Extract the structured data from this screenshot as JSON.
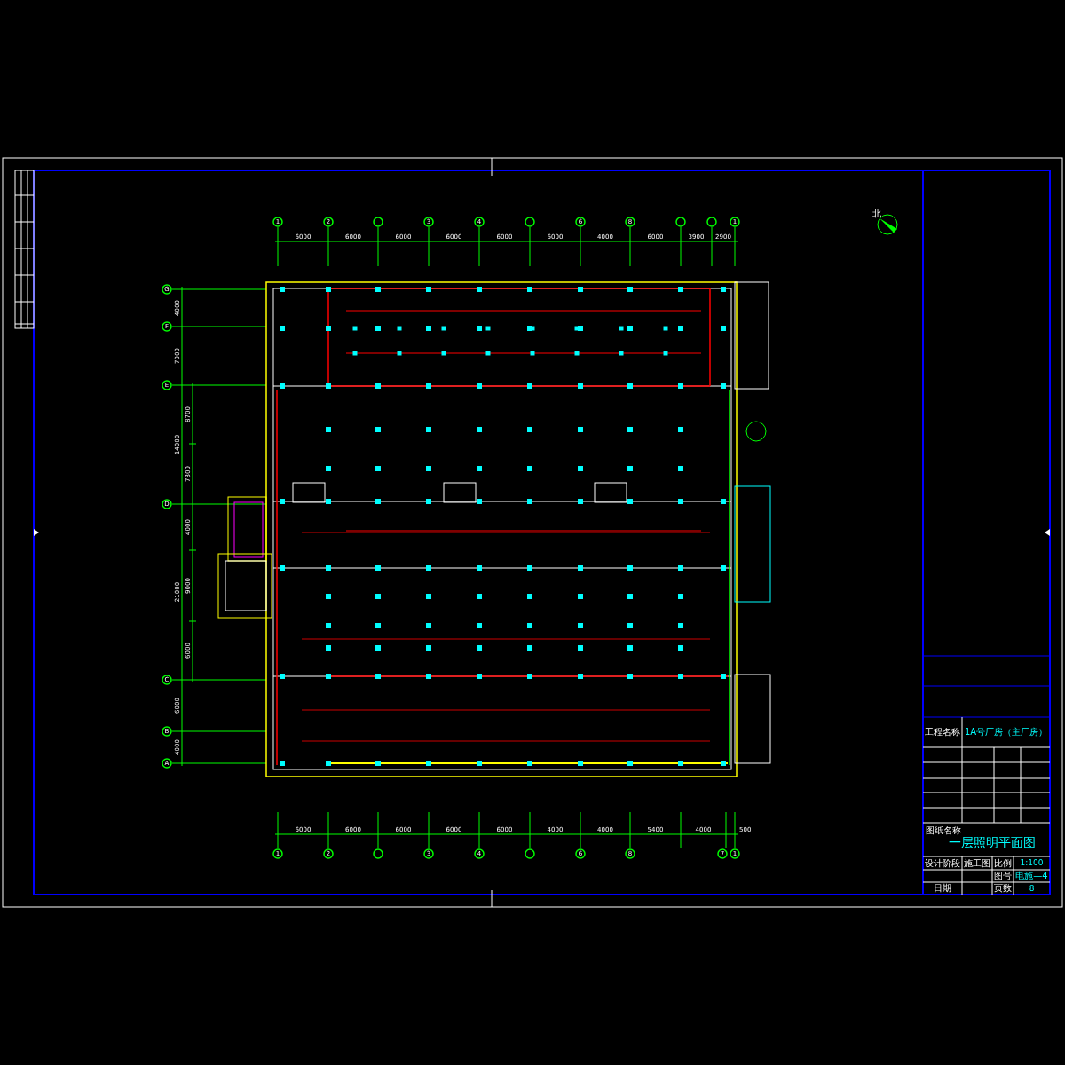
{
  "plan": {
    "north_label": "北",
    "top_axis": [
      {
        "kind": "labeled",
        "label": "1"
      },
      {
        "kind": "labeled",
        "label": "2"
      },
      {
        "kind": "unlabeled"
      },
      {
        "kind": "labeled",
        "label": "3"
      },
      {
        "kind": "labeled",
        "label": "4"
      },
      {
        "kind": "unlabeled"
      },
      {
        "kind": "labeled",
        "label": "6"
      },
      {
        "kind": "labeled",
        "label": "8"
      },
      {
        "kind": "unlabeled"
      },
      {
        "kind": "unlabeled"
      },
      {
        "kind": "labeled",
        "label": "1"
      }
    ],
    "top_dims": [
      "6000",
      "6000",
      "6000",
      "6000",
      "6000",
      "6000",
      "4000",
      "6000",
      "3900",
      "2900"
    ],
    "bottom_axis": [
      {
        "kind": "labeled",
        "label": "1"
      },
      {
        "kind": "labeled",
        "label": "2"
      },
      {
        "kind": "unlabeled"
      },
      {
        "kind": "labeled",
        "label": "3"
      },
      {
        "kind": "labeled",
        "label": "4"
      },
      {
        "kind": "unlabeled"
      },
      {
        "kind": "labeled",
        "label": "6"
      },
      {
        "kind": "labeled",
        "label": "8"
      },
      {
        "kind": "labeled",
        "label": "7"
      },
      {
        "kind": "labeled",
        "label": "1"
      }
    ],
    "bottom_dims": [
      "6000",
      "6000",
      "6000",
      "6000",
      "6000",
      "4000",
      "4000",
      "5400",
      "4000",
      "500"
    ],
    "left_axis": [
      {
        "kind": "labeled",
        "label": "G"
      },
      {
        "kind": "labeled",
        "label": "F"
      },
      {
        "kind": "labeled",
        "label": "E"
      },
      {
        "kind": "labeled",
        "label": "D"
      },
      {
        "kind": "labeled",
        "label": "C"
      },
      {
        "kind": "labeled",
        "label": "B"
      },
      {
        "kind": "labeled",
        "label": "A"
      }
    ],
    "left_outer_dims": [
      "4000",
      "7000",
      "14000",
      "21000",
      "6000",
      "4000"
    ],
    "left_inner_dims": [
      "8700",
      "7300",
      "4000",
      "9000",
      "6000"
    ]
  },
  "title_block": {
    "project_label": "工程名称",
    "project_name": "1A号厂房（主厂房）",
    "drawing_label": "图纸名称",
    "drawing_name": "一层照明平面图",
    "stage_label": "设计阶段",
    "stage": "施工图",
    "scale_label": "比例",
    "scale": "1:100",
    "number_label": "图号",
    "number": "电施—4",
    "date_label": "日期",
    "pages_label": "页数",
    "pages": "8"
  }
}
